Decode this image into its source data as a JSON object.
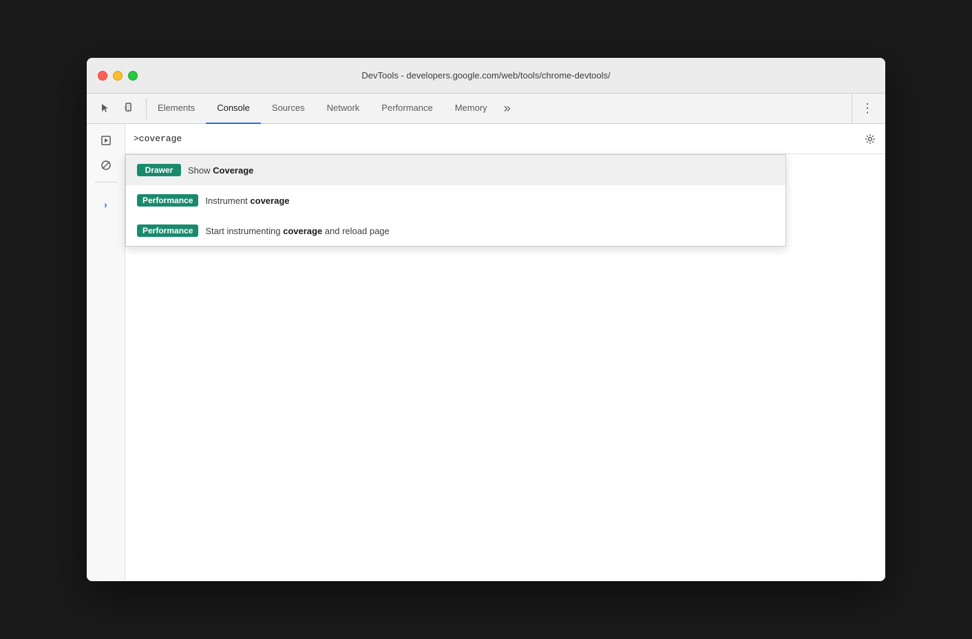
{
  "window": {
    "title": "DevTools - developers.google.com/web/tools/chrome-devtools/"
  },
  "toolbar": {
    "tabs": [
      {
        "id": "elements",
        "label": "Elements",
        "active": false
      },
      {
        "id": "console",
        "label": "Console",
        "active": true
      },
      {
        "id": "sources",
        "label": "Sources",
        "active": false
      },
      {
        "id": "network",
        "label": "Network",
        "active": false
      },
      {
        "id": "performance",
        "label": "Performance",
        "active": false
      },
      {
        "id": "memory",
        "label": "Memory",
        "active": false
      }
    ],
    "overflow_label": "»",
    "more_label": "⋮"
  },
  "console": {
    "input_value": ">coverage",
    "settings_tooltip": "Settings"
  },
  "autocomplete": {
    "items": [
      {
        "id": "show-coverage",
        "badge_label": "Drawer",
        "badge_class": "drawer",
        "text_before": "Show ",
        "text_bold": "Coverage",
        "text_after": ""
      },
      {
        "id": "instrument-coverage",
        "badge_label": "Performance",
        "badge_class": "performance",
        "text_before": "Instrument ",
        "text_bold": "coverage",
        "text_after": ""
      },
      {
        "id": "start-instrumenting-coverage",
        "badge_label": "Performance",
        "badge_class": "performance",
        "text_before": "Start instrumenting ",
        "text_bold": "coverage",
        "text_after": " and reload page"
      }
    ]
  },
  "sidebar": {
    "chevron_label": "›",
    "run_label": "▶"
  },
  "colors": {
    "accent_blue": "#1a73e8",
    "badge_green": "#1a8a6e",
    "active_tab_border": "#1a73e8"
  }
}
